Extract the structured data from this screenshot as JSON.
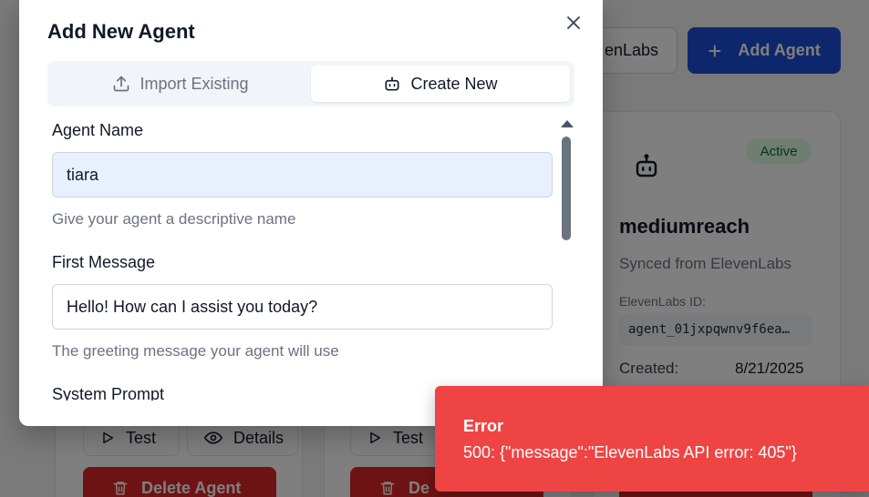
{
  "background": {
    "sync_button_label": "enLabs",
    "add_agent_label": "Add Agent",
    "card_main": {
      "status": "Active",
      "name": "mediumreach",
      "subtitle": "Synced from ElevenLabs",
      "id_label": "ElevenLabs ID:",
      "id_value": "agent_01jxpqwnv9f6ea…",
      "created_label": "Created:",
      "created_value": "8/21/2025"
    },
    "test_label": "Test",
    "details_label": "Details",
    "delete_label": "Delete Agent",
    "delete_label_partial": "De",
    "colors": {
      "primary": "#1d4ed8",
      "danger": "#dc2626",
      "badge_bg": "#dcfce7"
    }
  },
  "modal": {
    "title": "Add New Agent",
    "tabs": [
      {
        "label": "Import Existing",
        "icon": "upload-icon",
        "active": false
      },
      {
        "label": "Create New",
        "icon": "robot-icon",
        "active": true
      }
    ],
    "fields": {
      "agent_name": {
        "label": "Agent Name",
        "value": "tiara",
        "help": "Give your agent a descriptive name"
      },
      "first_message": {
        "label": "First Message",
        "value": "Hello! How can I assist you today?",
        "help": "The greeting message your agent will use"
      },
      "system_prompt": {
        "label": "System Prompt"
      }
    }
  },
  "toast": {
    "title": "Error",
    "message": "500: {\"message\":\"ElevenLabs API error: 405\"}",
    "color": "#ef4444"
  }
}
